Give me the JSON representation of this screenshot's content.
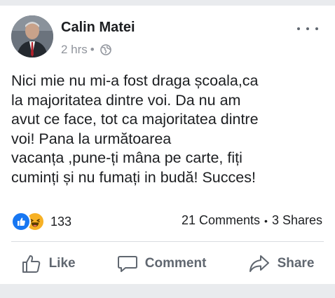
{
  "post": {
    "author": "Calin Matei",
    "timestamp": "2 hrs",
    "separator": "•",
    "privacy_icon": "globe-icon",
    "avatar_icon": "profile-photo",
    "menu_icon": "more-options-icon",
    "text_lines": [
      "Nici mie nu mi-a fost draga școala,ca",
      "la majoritatea dintre voi. Da nu am",
      "avut ce face, tot ca majoritatea dintre",
      "voi! Pana la următoarea",
      "vacanța ,pune-ți mâna pe carte, fiți",
      "cuminți și nu fumați in budă! Succes!"
    ]
  },
  "reactions": {
    "icons": [
      "like-reaction-icon",
      "haha-reaction-icon"
    ],
    "count": "133"
  },
  "engagement": {
    "comments": "21 Comments",
    "separator": "•",
    "shares": "3 Shares"
  },
  "actions": {
    "like": "Like",
    "comment": "Comment",
    "share": "Share"
  },
  "colors": {
    "text": "#1c1e21",
    "secondary": "#606770",
    "meta": "#90949c",
    "like_blue": "#1877f2",
    "haha_yellow": "#f7b125",
    "background_strip": "#e9ebee"
  }
}
